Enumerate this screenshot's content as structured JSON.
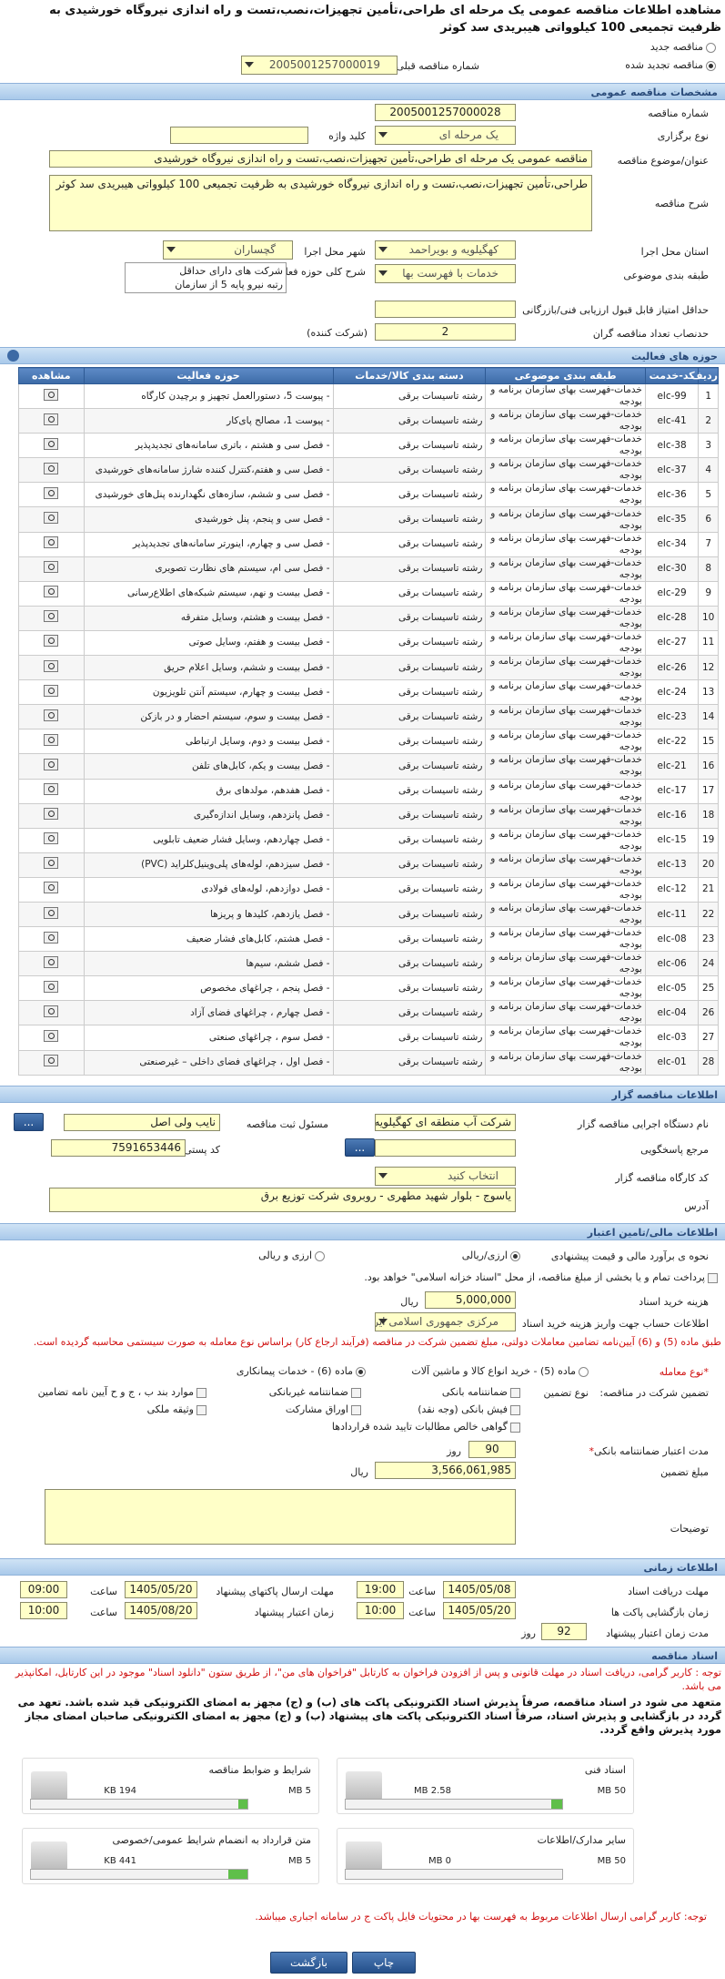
{
  "page_title": "مشاهده اطلاعات مناقصه عمومی یک مرحله ای طراحی،تأمین تجهیزات،نصب،تست و راه اندازی نیروگاه خورشیدی به ظرفیت تجمیعی 100 کیلوواتی هیبریدی سد کوثر",
  "mode": {
    "new": "مناقصه جدید",
    "renew": "مناقصه تجدید شده",
    "prev_label": "شماره مناقصه قبلی",
    "prev_value": "2005001257000019"
  },
  "sections": {
    "specs": "مشخصات مناقصه عمومی",
    "scope": "حوزه های فعالیت",
    "organizer": "اطلاعات مناقصه گزار",
    "finance": "اطلاعات مالی/تامین اعتبار",
    "timing": "اطلاعات زمانی",
    "docs": "اسناد مناقصه"
  },
  "specs": {
    "number_label": "شماره مناقصه",
    "number": "2005001257000028",
    "type_label": "نوع برگزاری",
    "type": "یک مرحله ای",
    "keyword_label": "کلید واژه",
    "keyword": "",
    "subject_label": "عنوان/موضوع مناقصه",
    "subject": "مناقصه عمومی یک مرحله ای طراحی،تأمین تجهیزات،نصب،تست و راه اندازی نیروگاه خورشیدی",
    "desc_label": "شرح مناقصه",
    "desc": "طراحی،تأمین تجهیزات،نصب،تست و راه اندازی نیروگاه خورشیدی به ظرفیت تجمیعی 100 کیلوواتی هیبریدی سد کوثر",
    "province_label": "استان محل اجرا",
    "province": "کهگیلویه و بویراحمد",
    "city_label": "شهر محل اجرا",
    "city": "گچساران",
    "category_label": "طبقه بندی موضوعی",
    "category": "خدمات با فهرست بها",
    "activity_label": "شرح کلی حوزه فعالیت",
    "activity_1": "شرکت های دارای حداقل",
    "activity_2": "رتبه نیرو پایه 5 از سازمان",
    "min_score_label": "حداقل امتیاز قابل قبول ارزیابی فنی/بازرگانی",
    "min_score": "",
    "min_bidders_label": "حدنصاب تعداد مناقصه گران",
    "min_bidders": "2",
    "min_bidders_unit": "(شرکت کننده)"
  },
  "table": {
    "headers": [
      "ردیف",
      "کد-خدمت",
      "طبقه بندی موضوعی",
      "دسته بندی کالا/خدمات",
      "حوزه فعالیت",
      "مشاهده"
    ],
    "rows": [
      [
        "1",
        "elc-99",
        "خدمات-فهرست بهای سازمان برنامه و بودجه",
        "رشته تاسیسات برقی",
        "- پیوست 5، دستورالعمل تجهیز و برچیدن کارگاه"
      ],
      [
        "2",
        "elc-41",
        "خدمات-فهرست بهای سازمان برنامه و بودجه",
        "رشته تاسیسات برقی",
        "- پیوست 1، مصالح پای‌کار"
      ],
      [
        "3",
        "elc-38",
        "خدمات-فهرست بهای سازمان برنامه و بودجه",
        "رشته تاسیسات برقی",
        "- فصل سی و هشتم ، باتری سامانه‌های تجدیدپذیر"
      ],
      [
        "4",
        "elc-37",
        "خدمات-فهرست بهای سازمان برنامه و بودجه",
        "رشته تاسیسات برقی",
        "- فصل سی و هفتم،کنترل کننده شارژ سامانه‌های خورشیدی"
      ],
      [
        "5",
        "elc-36",
        "خدمات-فهرست بهای سازمان برنامه و بودجه",
        "رشته تاسیسات برقی",
        "- فصل سی و ششم، سازه‌های نگهدارنده پنل‌های خورشیدی"
      ],
      [
        "6",
        "elc-35",
        "خدمات-فهرست بهای سازمان برنامه و بودجه",
        "رشته تاسیسات برقی",
        "- فصل سی و پنجم، پنل خورشیدی"
      ],
      [
        "7",
        "elc-34",
        "خدمات-فهرست بهای سازمان برنامه و بودجه",
        "رشته تاسیسات برقی",
        "- فصل سی و چهارم، اینورتر سامانه‌های تجدیدپذیر"
      ],
      [
        "8",
        "elc-30",
        "خدمات-فهرست بهای سازمان برنامه و بودجه",
        "رشته تاسیسات برقی",
        "- فصل سی ام، سیستم های نظارت تصویری"
      ],
      [
        "9",
        "elc-29",
        "خدمات-فهرست بهای سازمان برنامه و بودجه",
        "رشته تاسیسات برقی",
        "- فصل بیست و نهم، سیستم شبکه‌های اطلاع‌رسانی"
      ],
      [
        "10",
        "elc-28",
        "خدمات-فهرست بهای سازمان برنامه و بودجه",
        "رشته تاسیسات برقی",
        "- فصل بیست و هشتم، وسایل متفرقه"
      ],
      [
        "11",
        "elc-27",
        "خدمات-فهرست بهای سازمان برنامه و بودجه",
        "رشته تاسیسات برقی",
        "- فصل بیست و هفتم، وسایل صوتی"
      ],
      [
        "12",
        "elc-26",
        "خدمات-فهرست بهای سازمان برنامه و بودجه",
        "رشته تاسیسات برقی",
        "- فصل بیست و ششم، وسایل اعلام حریق"
      ],
      [
        "13",
        "elc-24",
        "خدمات-فهرست بهای سازمان برنامه و بودجه",
        "رشته تاسیسات برقی",
        "- فصل بیست و چهارم، سیستم آنتن تلویزیون"
      ],
      [
        "14",
        "elc-23",
        "خدمات-فهرست بهای سازمان برنامه و بودجه",
        "رشته تاسیسات برقی",
        "- فصل بیست و سوم، سیستم احضار و در بازکن"
      ],
      [
        "15",
        "elc-22",
        "خدمات-فهرست بهای سازمان برنامه و بودجه",
        "رشته تاسیسات برقی",
        "- فصل بیست و دوم، وسایل ارتباطی"
      ],
      [
        "16",
        "elc-21",
        "خدمات-فهرست بهای سازمان برنامه و بودجه",
        "رشته تاسیسات برقی",
        "- فصل بیست و یکم، کابل‌های تلفن"
      ],
      [
        "17",
        "elc-17",
        "خدمات-فهرست بهای سازمان برنامه و بودجه",
        "رشته تاسیسات برقی",
        "- فصل هفدهم، مولدهای برق"
      ],
      [
        "18",
        "elc-16",
        "خدمات-فهرست بهای سازمان برنامه و بودجه",
        "رشته تاسیسات برقی",
        "- فصل پانزدهم، وسایل اندازه‌گیری"
      ],
      [
        "19",
        "elc-15",
        "خدمات-فهرست بهای سازمان برنامه و بودجه",
        "رشته تاسیسات برقی",
        "- فصل چهاردهم، وسایل فشار ضعیف تابلویی"
      ],
      [
        "20",
        "elc-13",
        "خدمات-فهرست بهای سازمان برنامه و بودجه",
        "رشته تاسیسات برقی",
        "- فصل سیزدهم، لوله‌های پلی‌وینیل‌کلراید (PVC)"
      ],
      [
        "21",
        "elc-12",
        "خدمات-فهرست بهای سازمان برنامه و بودجه",
        "رشته تاسیسات برقی",
        "- فصل دوازدهم، لوله‌های فولادی"
      ],
      [
        "22",
        "elc-11",
        "خدمات-فهرست بهای سازمان برنامه و بودجه",
        "رشته تاسیسات برقی",
        "- فصل یازدهم، کلیدها و پریزها"
      ],
      [
        "23",
        "elc-08",
        "خدمات-فهرست بهای سازمان برنامه و بودجه",
        "رشته تاسیسات برقی",
        "- فصل هشتم، کابل‌های فشار ضعیف"
      ],
      [
        "24",
        "elc-06",
        "خدمات-فهرست بهای سازمان برنامه و بودجه",
        "رشته تاسیسات برقی",
        "- فصل ششم، سیم‌ها"
      ],
      [
        "25",
        "elc-05",
        "خدمات-فهرست بهای سازمان برنامه و بودجه",
        "رشته تاسیسات برقی",
        "- فصل پنجم ، چراغهای مخصوص"
      ],
      [
        "26",
        "elc-04",
        "خدمات-فهرست بهای سازمان برنامه و بودجه",
        "رشته تاسیسات برقی",
        "- فصل چهارم ، چراغهای فضای آزاد"
      ],
      [
        "27",
        "elc-03",
        "خدمات-فهرست بهای سازمان برنامه و بودجه",
        "رشته تاسیسات برقی",
        "- فصل سوم ، چراغهای صنعتی"
      ],
      [
        "28",
        "elc-01",
        "خدمات-فهرست بهای سازمان برنامه و بودجه",
        "رشته تاسیسات برقی",
        "- فصل اول ، چراغهای فضای داخلی – غیرصنعتی"
      ]
    ]
  },
  "organizer": {
    "agency_label": "نام دستگاه اجرایی مناقصه گزار",
    "agency": "شرکت آب منطقه ای کهگیلویه",
    "official_label": "مسئول ثبت مناقصه",
    "official": "نایب ولی اصل",
    "ref_label": "مرجع پاسخگویی",
    "ref": "",
    "postal_label": "کد پستی",
    "postal": "7591653446",
    "workshop_label": "کد کارگاه مناقصه گزار",
    "workshop": "انتخاب کنید",
    "address_label": "آدرس",
    "address": "یاسوج - بلوار شهید مطهری - روبروی شرکت توزیع برق",
    "more_button": "...",
    "ref_button": "..."
  },
  "finance": {
    "eval_label": "نحوه ی برآورد مالی و قیمت پیشنهادی",
    "eval_opt1": "ارزی/ریالی",
    "eval_opt2": "ارزی و ریالی",
    "pay_text": "پرداخت تمام و یا بخشی از مبلغ مناقصه، از محل \"اسناد خزانه اسلامی\" خواهد بود.",
    "doc_fee_label": "هزینه خرید اسناد",
    "doc_fee": "5,000,000",
    "doc_fee_unit": "ریال",
    "account_label": "اطلاعات حساب جهت واریز هزینه خرید اسناد",
    "account": "مرکزی جمهوری اسلامی ایران",
    "notice": "طبق ماده (5) و (6) آیین‌نامه تضامین معاملات دولتی، مبلغ تضمین شرکت در مناقصه (فرآیند ارجاع کار) براساس نوع معامله به صورت سیستمی محاسبه گردیده است.",
    "deal_label": "*نوع معامله",
    "deal_opt1": "ماده (5) - خرید انواع کالا و ماشین آلات",
    "deal_opt2": "ماده (6) - خدمات پیمانکاری",
    "guarantee_label": "تضمین شرکت در مناقصه:",
    "guarantee_type_label": "نوع تضمین",
    "g1": "ضمانتنامه بانکی",
    "g2": "ضمانتنامه غیربانکی",
    "g3": "موارد بند ب ، ج و ح آیین نامه تضامین",
    "g4": "فیش بانکی (وجه نقد)",
    "g5": "اوراق مشارکت",
    "g6": "وثیقه ملکی",
    "g7": "گواهی خالص مطالبات تایید شده قراردادها",
    "validity_label": "مدت اعتبار ضمانتنامه بانکی",
    "validity": "90",
    "validity_unit": "روز",
    "amount_label": "مبلغ تضمین",
    "amount": "3,566,061,985",
    "amount_unit": "ریال",
    "notes_label": "توضیحات",
    "notes": ""
  },
  "timing": {
    "recv_label": "مهلت دریافت اسناد",
    "recv_date": "1405/05/08",
    "recv_time": "19:00",
    "send_label": "مهلت ارسال پاکتهای پیشنهاد",
    "send_date": "1405/05/20",
    "send_time": "09:00",
    "open_label": "زمان بازگشایی پاکت ها",
    "open_date": "1405/05/20",
    "open_time": "10:00",
    "valid_label": "زمان اعتبار پیشنهاد",
    "valid_date": "1405/08/20",
    "valid_time": "10:00",
    "time_label": "ساعت",
    "min_valid_label": "مدت زمان اعتبار پیشنهاد",
    "min_valid": "92",
    "min_valid_unit": "روز"
  },
  "docs": {
    "note1": "توجه : کاربر گرامی، دریافت اسناد در مهلت قانونی و پس از افزودن فراخوان به کارتابل \"فراخوان های من\"، از طریق ستون \"دانلود اسناد\" موجود در این کارتابل، امکانپذیر می باشد.",
    "note2": "متعهد می شود در اسناد مناقصه، صرفاً پذیرش اسناد الکترونیکی پاکت های (ب) و (ج) مجهز به امضای الکترونیکی قید شده باشد. تعهد می گردد در بازگشایی و پذیرش اسناد، صرفاً اسناد الکترونیکی پاکت های پیشنهاد (ب) و (ج) مجهز به امضای الکترونیکی صاحبان امضای مجاز مورد پذیرش واقع گردد.",
    "files": [
      {
        "name": "شرایط و ضوابط مناقصه",
        "size": "194 KB",
        "max": "5 MB",
        "fill": 0.04
      },
      {
        "name": "اسناد فنی",
        "size": "2.58 MB",
        "max": "50 MB",
        "fill": 0.05
      },
      {
        "name": "متن قرارداد به انضمام شرایط عمومی/خصوصی",
        "size": "441 KB",
        "max": "5 MB",
        "fill": 0.09
      },
      {
        "name": "سایر مدارک/اطلاعات",
        "size": "0 MB",
        "max": "50 MB",
        "fill": 0
      }
    ],
    "note3": "توجه: کاربر گرامی ارسال اطلاعات مربوط به فهرست بها در محتویات فایل پاکت ج در سامانه اجباری میباشد."
  },
  "buttons": {
    "print": "چاپ",
    "back": "بازگشت"
  }
}
